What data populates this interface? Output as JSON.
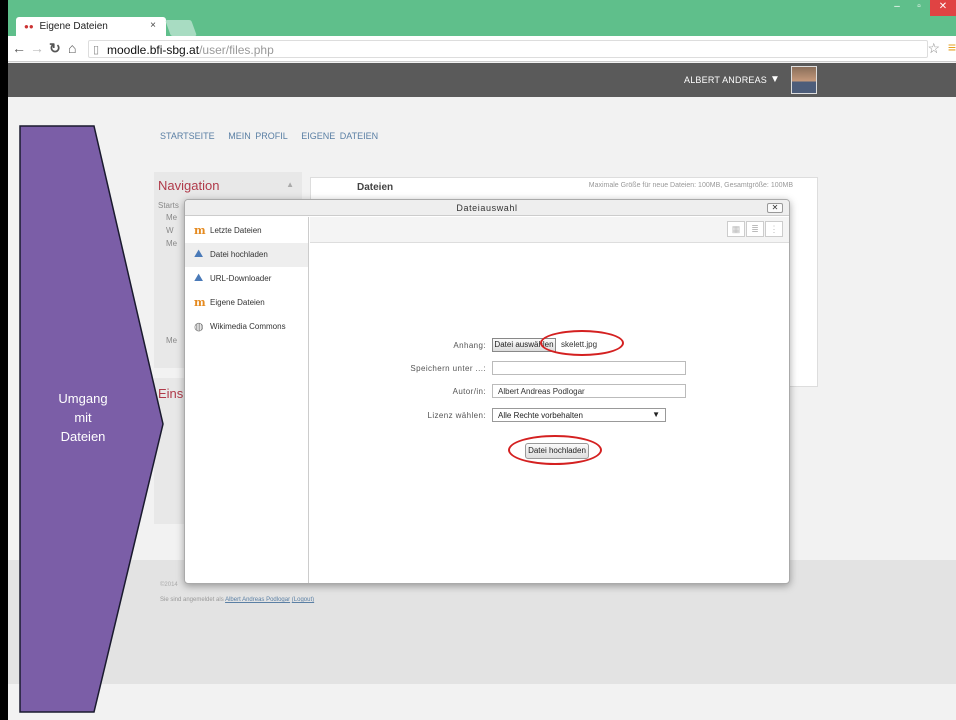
{
  "browser": {
    "tab_title": "Eigene Dateien",
    "tab_favicon": "moodle-favicon",
    "tab_close": "×",
    "url_host": "moodle.bfi-sbg.at",
    "url_path": "/user/files.php"
  },
  "header": {
    "user_name": "ALBERT ANDREAS"
  },
  "breadcrumb": [
    "STARTSEITE",
    "MEIN PROFIL",
    "EIGENE DATEIEN"
  ],
  "navigation": {
    "title": "Navigation",
    "partial_lines": [
      "Starts",
      "Me",
      "W",
      "Me",
      "Me"
    ]
  },
  "einstellungen": {
    "title_partial": "Eins"
  },
  "files": {
    "title": "Dateien",
    "max_size": "Maximale Größe für neue Dateien: 100MB, Gesamtgröße: 100MB"
  },
  "footer": {
    "copyright_partial": "©2014",
    "login_prefix": "Sie sind angemeldet als",
    "login_user": "Albert Andreas Podlogar",
    "logout": "(Logout)"
  },
  "overlay": {
    "label_lines": [
      "Umgang",
      "mit",
      "Dateien"
    ],
    "arrow_color": "#7b5ea7"
  },
  "dialog": {
    "title": "Dateiauswahl",
    "close": "✕",
    "repositories": [
      {
        "label": "Letzte Dateien",
        "icon": "moodle-icon"
      },
      {
        "label": "Datei hochladen",
        "icon": "upload-icon"
      },
      {
        "label": "URL-Downloader",
        "icon": "url-downloader-icon"
      },
      {
        "label": "Eigene Dateien",
        "icon": "moodle-icon"
      },
      {
        "label": "Wikimedia Commons",
        "icon": "wikimedia-icon"
      }
    ],
    "form": {
      "attachment_label": "Anhang:",
      "choose_button": "Datei auswählen",
      "chosen_file": "skelett.jpg",
      "save_as_label": "Speichern unter ...:",
      "save_as_value": "",
      "author_label": "Autor/in:",
      "author_value": "Albert Andreas Podlogar",
      "license_label": "Lizenz wählen:",
      "license_value": "Alle Rechte vorbehalten",
      "upload_button": "Datei hochladen"
    }
  },
  "colors": {
    "chrome_green": "#5fbf8b",
    "moodle_header": "#5a5a5a",
    "link": "#5a7fa4",
    "block_title": "#b03a4a",
    "highlight": "#d42020"
  }
}
